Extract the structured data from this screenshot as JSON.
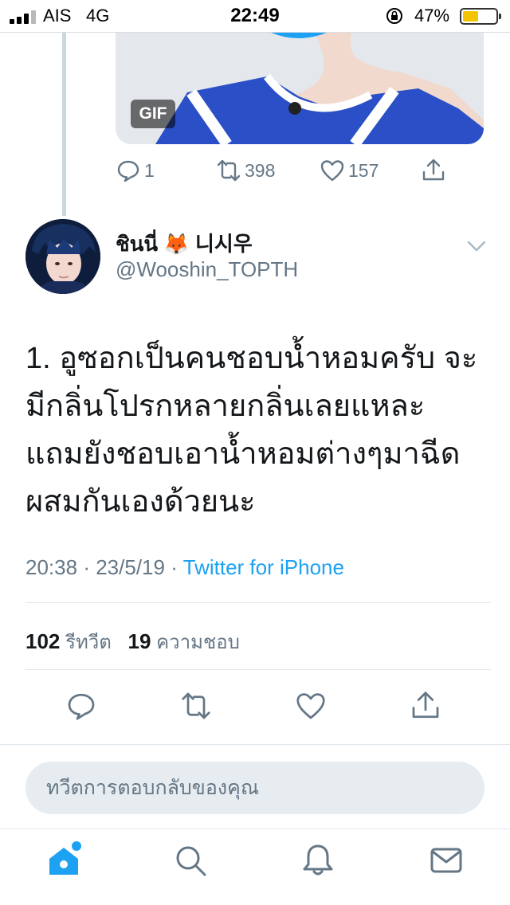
{
  "status_bar": {
    "carrier": "AIS",
    "network": "4G",
    "time": "22:49",
    "battery_percent": "47%",
    "battery_level": 0.47,
    "battery_color": "#f5c400"
  },
  "parent_tweet": {
    "media_badge": "GIF",
    "reply_count": "1",
    "retweet_count": "398",
    "like_count": "157",
    "icons": [
      "reply-icon",
      "retweet-icon",
      "like-icon",
      "share-icon"
    ]
  },
  "tweet": {
    "display_name": "ชินนี่ 🦊 니시우",
    "handle": "@Wooshin_TOPTH",
    "text_lines": [
      "1. อูซอกเป็นคนชอบน้ำหอมครับ จะ",
      "มีกลิ่นโปรกหลายกลิ่นเลยแหละ",
      "แถมยังชอบเอาน้ำหอมต่างๆมาฉีด",
      "ผสมกันเองด้วยนะ"
    ],
    "time": "20:38",
    "date": "23/5/19",
    "separator": "·",
    "source": "Twitter for iPhone",
    "retweets": "102",
    "retweets_label": "รีทวีต",
    "likes": "19",
    "likes_label": "ความชอบ"
  },
  "reply": {
    "placeholder": "ทวีตการตอบกลับของคุณ"
  },
  "tab_bar": {
    "items": [
      "home-icon",
      "search-icon",
      "notifications-icon",
      "messages-icon"
    ],
    "active": "home-icon"
  },
  "colors": {
    "accent": "#1da1f2",
    "muted": "#657786",
    "text": "#14171a"
  }
}
